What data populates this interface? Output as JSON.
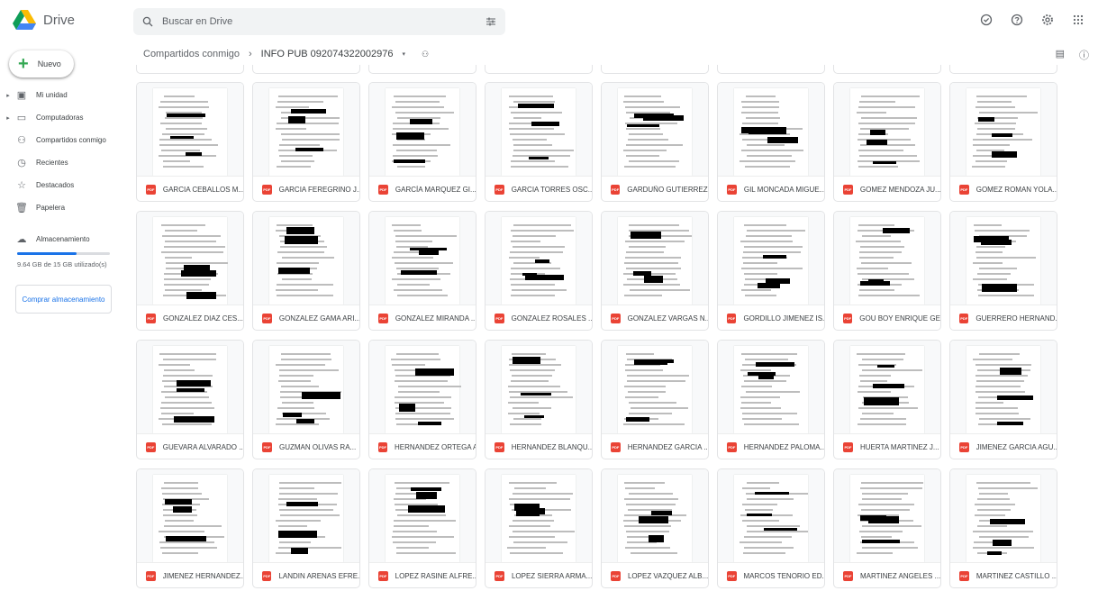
{
  "app": {
    "name": "Drive",
    "search_placeholder": "Buscar en Drive"
  },
  "sidebar": {
    "new_label": "Nuevo",
    "items": [
      {
        "label": "Mi unidad",
        "icon": "drive-icon",
        "caret": true
      },
      {
        "label": "Computadoras",
        "icon": "computer-icon",
        "caret": true
      },
      {
        "label": "Compartidos conmigo",
        "icon": "shared-icon",
        "caret": false
      },
      {
        "label": "Recientes",
        "icon": "clock-icon",
        "caret": false
      },
      {
        "label": "Destacados",
        "icon": "star-icon",
        "caret": false
      },
      {
        "label": "Papelera",
        "icon": "trash-icon",
        "caret": false
      }
    ],
    "storage": {
      "label": "Almacenamiento",
      "usage_text": "9.64 GB de 15 GB utilizado(s)",
      "used_fraction": 0.64,
      "buy_label": "Comprar almacenamiento"
    }
  },
  "breadcrumb": {
    "parent": "Compartidos conmigo",
    "current": "INFO PUB 092074322002976"
  },
  "colors": {
    "accent": "#1a73e8",
    "pdf": "#ea4335",
    "new_plus": "#34a853"
  },
  "files": [
    "GARCIA CEBALLOS M...",
    "GARCIA FEREGRINO J...",
    "GARCÍA MARQUEZ GI...",
    "GARCIA TORRES OSC...",
    "GARDUÑO GUTIERREZ...",
    "GIL MONCADA MIGUE...",
    "GOMEZ MENDOZA JU...",
    "GOMEZ ROMAN YOLA...",
    "GONZALEZ DIAZ CES...",
    "GONZALEZ GAMA ARI...",
    "GONZALEZ MIRANDA ...",
    "GONZALEZ ROSALES ...",
    "GONZALEZ VARGAS N...",
    "GORDILLO JIMENEZ IS...",
    "GOU BOY ENRIQUE GE...",
    "GUERRERO HERNAND...",
    "GUEVARA ALVARADO ...",
    "GUZMAN OLIVAS RA...",
    "HERNANDEZ ORTEGA A...",
    "HERNANDEZ BLANQU...",
    "HERNANDEZ GARCIA ...",
    "HERNANDEZ PALOMA...",
    "HUERTA MARTINEZ J...",
    "JIMENEZ GARCIA AGU...",
    "JIMENEZ HERNANDEZ...",
    "LANDIN ARENAS EFRE...",
    "LOPEZ RASINE ALFRE...",
    "LOPEZ SIERRA ARMA...",
    "LOPEZ VAZQUEZ ALB...",
    "MARCOS TENORIO ED...",
    "MARTINEZ ANGELES ...",
    "MARTINEZ CASTILLO ..."
  ],
  "pdf_badge": "PDF"
}
